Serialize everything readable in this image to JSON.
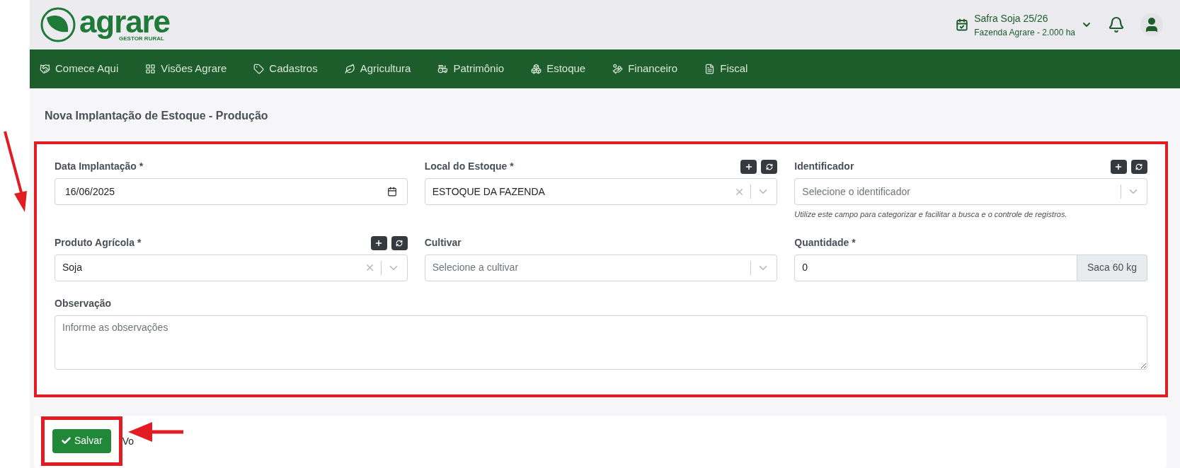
{
  "header": {
    "logo": {
      "name": "agrare",
      "tagline": "GESTOR RURAL"
    },
    "season": {
      "title": "Safra Soja 25/26",
      "subtitle": "Fazenda Agrare - 2.000 ha"
    }
  },
  "nav": {
    "items": [
      {
        "label": "Comece Aqui"
      },
      {
        "label": "Visões Agrare"
      },
      {
        "label": "Cadastros"
      },
      {
        "label": "Agricultura"
      },
      {
        "label": "Patrimônio"
      },
      {
        "label": "Estoque"
      },
      {
        "label": "Financeiro"
      },
      {
        "label": "Fiscal"
      }
    ]
  },
  "page_title": "Nova Implantação de Estoque - Produção",
  "form": {
    "fields": [
      {
        "kind": "date",
        "label": "Data Implantação *",
        "value": "16/06/2025",
        "actions": false
      },
      {
        "kind": "select",
        "label": "Local do Estoque *",
        "value": "ESTOQUE DA FAZENDA",
        "clearable": true,
        "actions": true
      },
      {
        "kind": "select",
        "label": "Identificador",
        "placeholder": "Selecione o identificador",
        "clearable": false,
        "actions": true,
        "help": "Utilize este campo para categorizar e facilitar a busca e o controle de registros."
      },
      {
        "kind": "select",
        "label": "Produto Agrícola *",
        "value": "Soja",
        "clearable": true,
        "actions": true
      },
      {
        "kind": "select",
        "label": "Cultivar",
        "placeholder": "Selecione a cultivar",
        "clearable": false,
        "actions": false
      },
      {
        "kind": "quantity",
        "label": "Quantidade *",
        "value": "0",
        "unit": "Saca 60 kg",
        "actions": false
      },
      {
        "kind": "textarea",
        "label": "Observação",
        "placeholder": "Informe as observações",
        "actions": false
      }
    ]
  },
  "footer": {
    "save": "Salvar",
    "back": "Vo"
  }
}
